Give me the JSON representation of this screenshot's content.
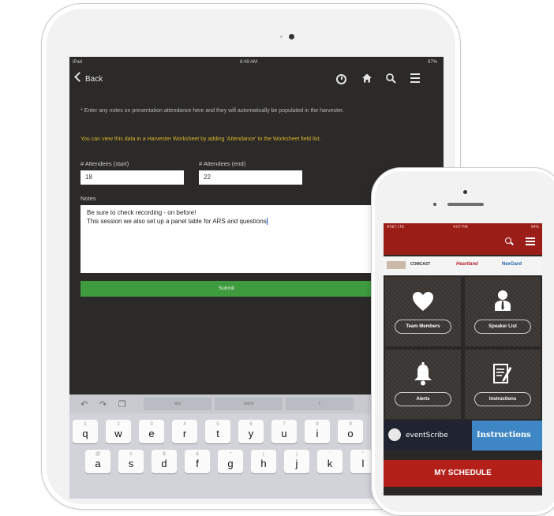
{
  "ipad": {
    "status": {
      "carrier": "iPad",
      "time": "8:49 AM",
      "battery": "97%"
    },
    "nav": {
      "back_label": "Back",
      "icons": [
        "clock-check-icon",
        "home-icon",
        "search-icon",
        "menu-icon"
      ]
    },
    "content": {
      "note_gray": "* Enter any notes on presentation attendance here and they will automatically be populated in the harvester.",
      "note_yellow": "You can view this data in a Harvester Worksheet by adding 'Attendance' to the Worksheet field list.",
      "attendees_start_label": "# Attendees (start)",
      "attendees_start_value": "18",
      "attendees_end_label": "# Attendees (end)",
      "attendees_end_value": "22",
      "notes_label": "Notes",
      "notes_line1": "Be sure to check recording - on before!",
      "notes_line2": "This session we also set up a panel table for ARS and questions",
      "submit_label": "Submit"
    },
    "keyboard": {
      "suggestions": [
        "are",
        "were",
        "I"
      ],
      "row1": [
        {
          "alt": "1",
          "key": "q"
        },
        {
          "alt": "2",
          "key": "w"
        },
        {
          "alt": "3",
          "key": "e"
        },
        {
          "alt": "4",
          "key": "r"
        },
        {
          "alt": "5",
          "key": "t"
        },
        {
          "alt": "6",
          "key": "y"
        },
        {
          "alt": "7",
          "key": "u"
        },
        {
          "alt": "8",
          "key": "i"
        },
        {
          "alt": "9",
          "key": "o"
        }
      ],
      "row2": [
        {
          "alt": "@",
          "key": "a"
        },
        {
          "alt": "#",
          "key": "s"
        },
        {
          "alt": "$",
          "key": "d"
        },
        {
          "alt": "&",
          "key": "f"
        },
        {
          "alt": "*",
          "key": "g"
        },
        {
          "alt": "(",
          "key": "h"
        },
        {
          "alt": ")",
          "key": "j"
        },
        {
          "alt": "'",
          "key": "k"
        },
        {
          "alt": "\"",
          "key": "l"
        }
      ]
    }
  },
  "iphone": {
    "status": {
      "carrier": "AT&T LTE",
      "time": "4:07 PM",
      "battery": "84%"
    },
    "sponsors": [
      "COMCAST",
      "Heartland",
      "NexGard"
    ],
    "tiles": [
      {
        "label": "Team Members",
        "icon": "heart-icon"
      },
      {
        "label": "Speaker List",
        "icon": "speaker-person-icon"
      },
      {
        "label": "Alerts",
        "icon": "bell-icon"
      },
      {
        "label": "Instructions",
        "icon": "edit-note-icon"
      }
    ],
    "banner": {
      "brand": "eventScribe",
      "instructions": "Instructions"
    },
    "my_schedule": "MY SCHEDULE"
  }
}
